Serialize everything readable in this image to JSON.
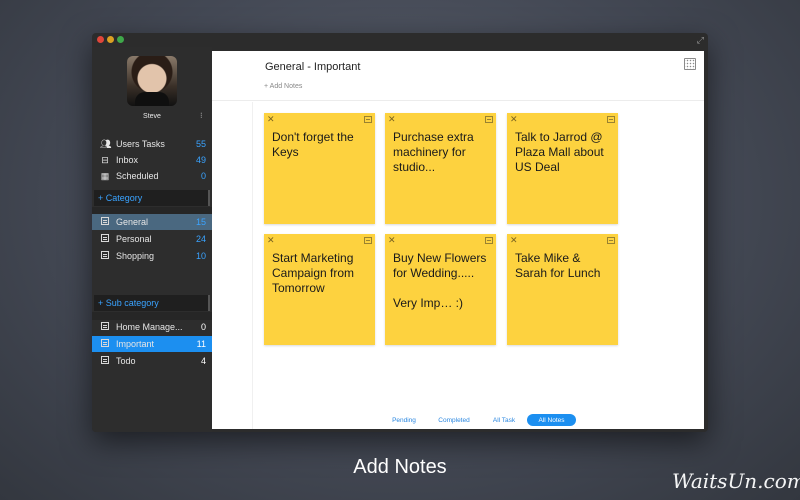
{
  "window": {
    "controls": [
      "close",
      "minimize",
      "zoom"
    ],
    "fullscreen_icon": "fullscreen-arrows-icon"
  },
  "sidebar": {
    "user": {
      "name": "Steve",
      "menu_glyph": "⁝"
    },
    "top_items": [
      {
        "label": "Users Tasks",
        "count": "55",
        "icon": "users-icon"
      },
      {
        "label": "Inbox",
        "count": "49",
        "icon": "inbox-icon"
      },
      {
        "label": "Scheduled",
        "count": "0",
        "icon": "calendar-icon"
      }
    ],
    "add_category": "+ Category",
    "categories": [
      {
        "label": "General",
        "count": "15",
        "selected": true
      },
      {
        "label": "Personal",
        "count": "24",
        "selected": false
      },
      {
        "label": "Shopping",
        "count": "10",
        "selected": false
      }
    ],
    "add_subcategory": "+ Sub category",
    "subcategories": [
      {
        "label": "Home Manage...",
        "count": "0",
        "selected": false
      },
      {
        "label": "Important",
        "count": "11",
        "selected": true
      },
      {
        "label": "Todo",
        "count": "4",
        "selected": false
      }
    ]
  },
  "main": {
    "title": "General - Important",
    "add_notes": "+ Add Notes",
    "notes": [
      {
        "text": "Don't forget the Keys"
      },
      {
        "text": "Purchase extra machinery for studio..."
      },
      {
        "text": "Talk to Jarrod @ Plaza Mall about US Deal"
      },
      {
        "text": "Start Marketing Campaign from Tomorrow"
      },
      {
        "text": "Buy New Flowers for Wedding.....\n\nVery Imp… :)"
      },
      {
        "text": "Take Mike & Sarah for Lunch"
      }
    ],
    "filters": [
      {
        "label": "Pending",
        "active": false
      },
      {
        "label": "Completed",
        "active": false
      },
      {
        "label": "All Task",
        "active": false
      },
      {
        "label": "All Notes",
        "active": true
      }
    ]
  },
  "caption": "Add Notes",
  "watermark": "WaitsUn.com",
  "colors": {
    "accent": "#1c8ff0",
    "note_yellow": "#fdd23f",
    "sidebar_bg": "#2d2d2d",
    "count_blue": "#3aa3ff"
  }
}
